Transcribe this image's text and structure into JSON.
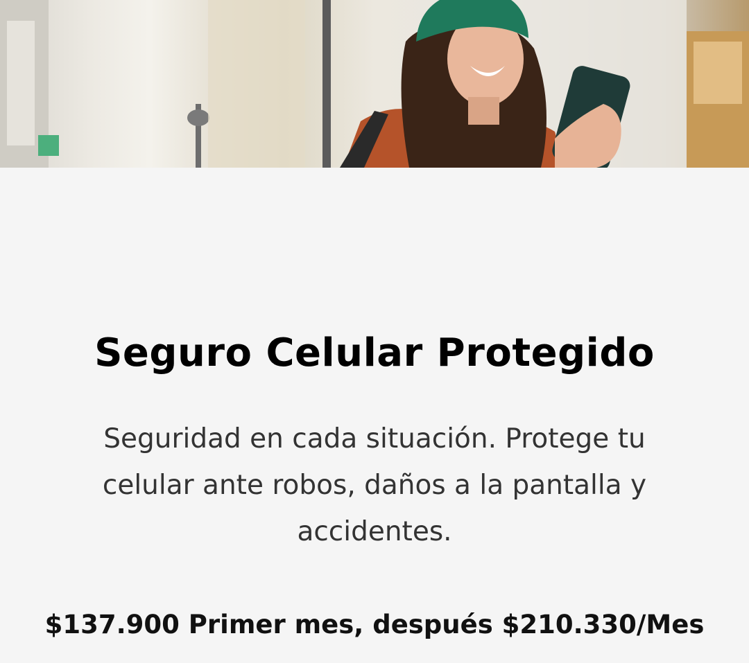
{
  "hero": {
    "image_description_icon": "person-with-phone-illustration"
  },
  "product": {
    "title": "Seguro Celular Protegido",
    "description": "Seguridad en cada situación. Protege tu celular ante robos, daños a la pantalla y accidentes.",
    "price_text": "$137.900 Primer mes, después $210.330/Mes"
  },
  "colors": {
    "background": "#f5f5f5",
    "title": "#000000",
    "description": "#333333",
    "beanie": "#1f7a5c",
    "jacket": "#b5532a"
  }
}
